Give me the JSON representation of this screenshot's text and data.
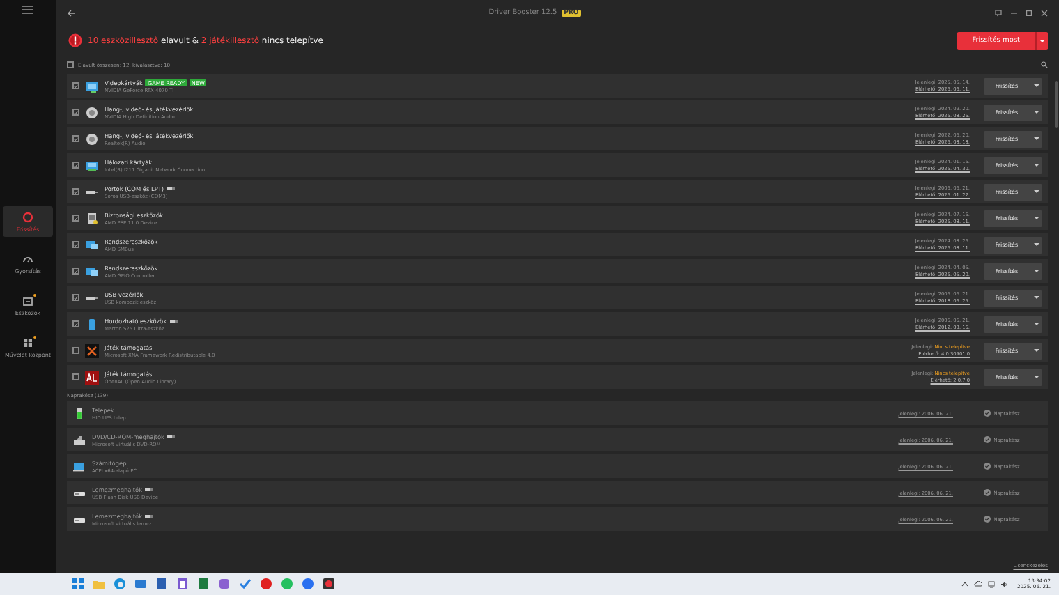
{
  "window": {
    "title": "Driver Booster 12.5",
    "edition_badge": "PRO"
  },
  "sidebar": {
    "items": [
      {
        "label": "Frissítés",
        "selected": true
      },
      {
        "label": "Gyorsítás",
        "selected": false
      },
      {
        "label": "Eszközök",
        "selected": false,
        "dot": true
      },
      {
        "label": "Művelet központ",
        "selected": false,
        "dot": true
      }
    ]
  },
  "alert": {
    "parts": [
      {
        "text": "10 eszközillesztő",
        "highlight": true
      },
      {
        "text": " elavult & ",
        "highlight": false
      },
      {
        "text": "2 játékillesztő",
        "highlight": true
      },
      {
        "text": " nincs telepítve",
        "highlight": false
      }
    ]
  },
  "update_all_button": "Frissítés most",
  "select_all": {
    "label": "Elavult összesen: 12, kiválasztva: 10",
    "checked": false
  },
  "outdated": [
    {
      "category": "Videokártyák",
      "device": "NVIDIA GeForce RTX 4070 Ti",
      "badges": [
        "GAME READY",
        "NEW"
      ],
      "checked": true,
      "current": "Jelenlegi: 2025. 05. 14.",
      "available": "Elérhető: 2025. 06. 11.",
      "button": "Frissítés"
    },
    {
      "category": "Hang-, videó- és játékvezérlők",
      "device": "NVIDIA High Definition Audio",
      "checked": true,
      "current": "Jelenlegi: 2024. 09. 20.",
      "available": "Elérhető: 2025. 03. 26.",
      "button": "Frissítés"
    },
    {
      "category": "Hang-, videó- és játékvezérlők",
      "device": "Realtek(R) Audio",
      "checked": true,
      "current": "Jelenlegi: 2022. 06. 20.",
      "available": "Elérhető: 2025. 03. 13.",
      "button": "Frissítés"
    },
    {
      "category": "Hálózati kártyák",
      "device": "Intel(R) I211 Gigabit Network Connection",
      "checked": true,
      "current": "Jelenlegi: 2024. 01. 15.",
      "available": "Elérhető: 2025. 04. 30.",
      "button": "Frissítés"
    },
    {
      "category": "Portok (COM és LPT)",
      "device": "Soros USB-eszköz (COM3)",
      "usb": true,
      "checked": true,
      "current": "Jelenlegi: 2006. 06. 21.",
      "available": "Elérhető: 2025. 01. 22.",
      "button": "Frissítés"
    },
    {
      "category": "Biztonsági eszközök",
      "device": "AMD PSP 11.0 Device",
      "checked": true,
      "current": "Jelenlegi: 2024. 07. 16.",
      "available": "Elérhető: 2025. 03. 11.",
      "button": "Frissítés"
    },
    {
      "category": "Rendszereszközök",
      "device": "AMD SMBus",
      "checked": true,
      "current": "Jelenlegi: 2024. 03. 26.",
      "available": "Elérhető: 2025. 03. 11.",
      "button": "Frissítés"
    },
    {
      "category": "Rendszereszközök",
      "device": "AMD GPIO Controller",
      "checked": true,
      "current": "Jelenlegi: 2024. 04. 05.",
      "available": "Elérhető: 2025. 05. 20.",
      "button": "Frissítés"
    },
    {
      "category": "USB-vezérlők",
      "device": "USB kompozit eszköz",
      "checked": true,
      "current": "Jelenlegi: 2006. 06. 21.",
      "available": "Elérhető: 2018. 06. 25.",
      "button": "Frissítés"
    },
    {
      "category": "Hordozható eszközök",
      "device": "Marton S25 Ultra-eszköz",
      "usb": true,
      "checked": true,
      "current": "Jelenlegi: 2006. 06. 21.",
      "available": "Elérhető: 2012. 03. 16.",
      "button": "Frissítés"
    },
    {
      "category": "Játék támogatás",
      "device": "Microsoft XNA Framework Redistributable 4.0",
      "checked": false,
      "current": "Jelenlegi:",
      "current_status": "Nincs telepítve",
      "available": "Elérhető: 4.0.30901.0",
      "button": "Frissítés"
    },
    {
      "category": "Játék támogatás",
      "device": "OpenAL (Open Audio Library)",
      "checked": false,
      "current": "Jelenlegi:",
      "current_status": "Nincs telepítve",
      "available": "Elérhető: 2.0.7.0",
      "button": "Frissítés"
    }
  ],
  "up_to_date": {
    "title": "Naprakész (139)",
    "rows": [
      {
        "category": "Telepek",
        "device": "HID UPS telep",
        "current": "Jelenlegi: 2006. 06. 21.",
        "status": "Naprakész"
      },
      {
        "category": "DVD/CD-ROM-meghajtók",
        "device": "Microsoft virtuális DVD-ROM",
        "usb": true,
        "current": "Jelenlegi: 2006. 06. 21.",
        "status": "Naprakész"
      },
      {
        "category": "Számítógép",
        "device": "ACPI x64-alapú PC",
        "current": "Jelenlegi: 2006. 06. 21.",
        "status": "Naprakész"
      },
      {
        "category": "Lemezmeghajtók",
        "device": "USB Flash Disk USB Device",
        "usb": true,
        "current": "Jelenlegi: 2006. 06. 21.",
        "status": "Naprakész"
      },
      {
        "category": "Lemezmeghajtók",
        "device": "Microsoft virtuális lemez",
        "usb": true,
        "current": "Jelenlegi: 2006. 06. 21.",
        "status": "Naprakész"
      }
    ]
  },
  "footer_link": "Licenckezelés",
  "taskbar": {
    "time": "13:34:02",
    "date": "2025. 06. 21."
  }
}
